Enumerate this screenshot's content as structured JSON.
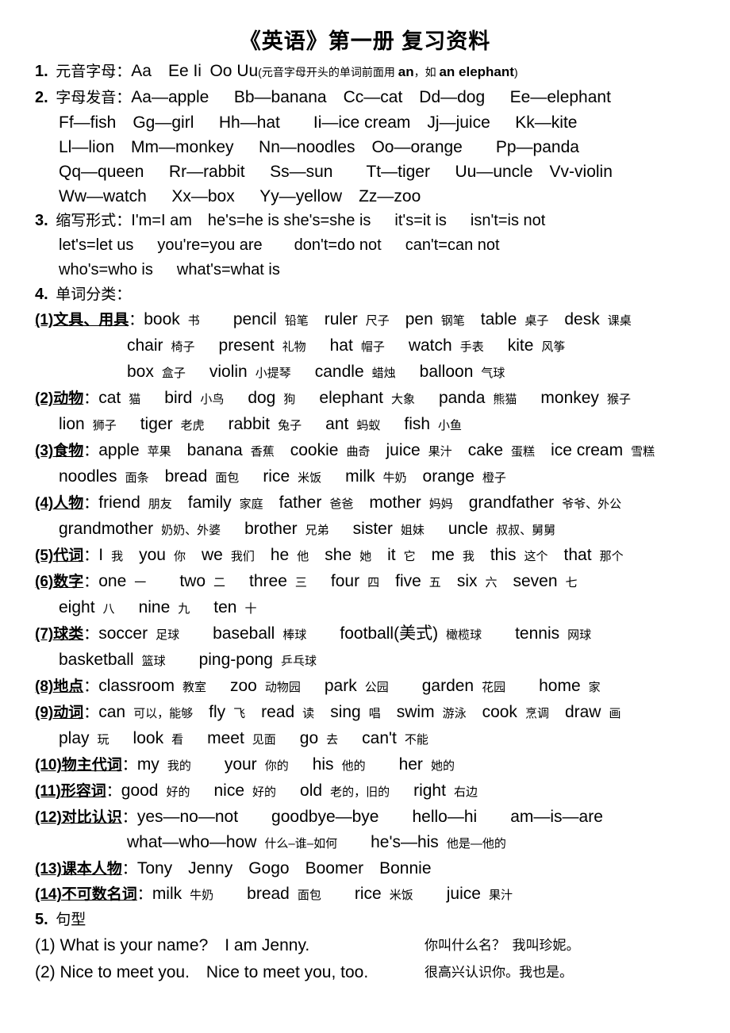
{
  "document": {
    "title": "《英语》第一册 复习资料"
  },
  "sections": {
    "s1": {
      "num": "1.",
      "label": "元音字母：",
      "vowels": "Aa Ee Ii Oo Uu",
      "note_open": "(",
      "note_pre": "元音字母开头的单词前面用 ",
      "note_b1": "an",
      "note_mid": "，如 ",
      "note_b2": "an elephant",
      "note_close": ")"
    },
    "s2": {
      "num": "2.",
      "label": "字母发音：",
      "rows": [
        "Aa—apple  Bb—banana Cc—cat  Dd—dog  Ee—elephant",
        "Ff—fish Gg—girl  Hh—hat   Ii—ice cream Jj—juice  Kk—kite",
        "Ll—lion Mm—monkey  Nn—noodles Oo—orange   Pp—panda",
        "Qq—queen  Rr—rabbit  Ss—sun   Tt—tiger  Uu—uncle Vv-violin",
        "Ww—watch  Xx—box  Yy—yellow Zz—zoo"
      ]
    },
    "s3": {
      "num": "3.",
      "label": "缩写形式：",
      "rows": [
        "I'm=I am he's=he is she's=she is  it's=it is  isn't=is not",
        "let's=let us  you're=you are  don't=do not  can't=can not",
        "who's=who is  what's=what is"
      ]
    },
    "s4": {
      "num": "4.",
      "label": "单词分类：",
      "categories": [
        {
          "id": "cat-1",
          "label": "(1)文具、用具",
          "colon": "：",
          "lines": [
            [
              {
                "en": "book",
                "gl": "书",
                "gap": "sp4"
              },
              {
                "en": "pencil",
                "gl": "铅笔",
                "gap": "sp2"
              },
              {
                "en": "ruler",
                "gl": "尺子",
                "gap": "sp2"
              },
              {
                "en": "pen",
                "gl": "钢笔",
                "gap": "sp2"
              },
              {
                "en": "table",
                "gl": "桌子",
                "gap": "sp2"
              },
              {
                "en": "desk",
                "gl": "课桌",
                "gap": "sp1"
              }
            ],
            [
              {
                "en": "chair",
                "gl": "椅子",
                "gap": "sp3"
              },
              {
                "en": "present",
                "gl": "礼物",
                "gap": "sp3"
              },
              {
                "en": "hat",
                "gl": "帽子",
                "gap": "sp3"
              },
              {
                "en": "watch",
                "gl": "手表",
                "gap": "sp3"
              },
              {
                "en": "kite",
                "gl": "风筝",
                "gap": "sp1"
              }
            ],
            [
              {
                "en": "box",
                "gl": "盒子",
                "gap": "sp3"
              },
              {
                "en": "violin",
                "gl": "小提琴",
                "gap": "sp3"
              },
              {
                "en": "candle",
                "gl": "蜡烛",
                "gap": "sp3"
              },
              {
                "en": "balloon",
                "gl": "气球",
                "gap": "sp1"
              }
            ]
          ],
          "indent": [
            "",
            "ind3",
            "ind3"
          ]
        },
        {
          "id": "cat-2",
          "label": "(2)动物",
          "colon": "：",
          "lines": [
            [
              {
                "en": "cat",
                "gl": "猫",
                "gap": "sp3"
              },
              {
                "en": "bird",
                "gl": "小鸟",
                "gap": "sp3"
              },
              {
                "en": "dog",
                "gl": "狗",
                "gap": "sp3"
              },
              {
                "en": "elephant",
                "gl": "大象",
                "gap": "sp3"
              },
              {
                "en": "panda",
                "gl": "熊猫",
                "gap": "sp3"
              },
              {
                "en": "monkey",
                "gl": "猴子",
                "gap": "sp1"
              }
            ],
            [
              {
                "en": "lion",
                "gl": "狮子",
                "gap": "sp3"
              },
              {
                "en": "tiger",
                "gl": "老虎",
                "gap": "sp3"
              },
              {
                "en": "rabbit",
                "gl": "兔子",
                "gap": "sp3"
              },
              {
                "en": "ant",
                "gl": "蚂蚁",
                "gap": "sp3"
              },
              {
                "en": "fish",
                "gl": "小鱼",
                "gap": "sp1"
              }
            ]
          ],
          "indent": [
            "",
            "ind1"
          ]
        },
        {
          "id": "cat-3",
          "label": "(3)食物",
          "colon": "：",
          "lines": [
            [
              {
                "en": "apple",
                "gl": "苹果",
                "gap": "sp2"
              },
              {
                "en": "banana",
                "gl": "香蕉",
                "gap": "sp2"
              },
              {
                "en": "cookie",
                "gl": "曲奇",
                "gap": "sp2"
              },
              {
                "en": "juice",
                "gl": "果汁",
                "gap": "sp2"
              },
              {
                "en": "cake",
                "gl": "蛋糕",
                "gap": "sp2"
              },
              {
                "en": "ice cream",
                "gl": "雪糕",
                "gap": "sp1"
              }
            ],
            [
              {
                "en": "noodles",
                "gl": "面条",
                "gap": "sp2"
              },
              {
                "en": "bread",
                "gl": "面包",
                "gap": "sp3"
              },
              {
                "en": "rice",
                "gl": "米饭",
                "gap": "sp3"
              },
              {
                "en": "milk",
                "gl": "牛奶",
                "gap": "sp2"
              },
              {
                "en": "orange",
                "gl": "橙子",
                "gap": "sp1"
              }
            ]
          ],
          "indent": [
            "",
            "ind1"
          ]
        },
        {
          "id": "cat-4",
          "label": "(4)人物",
          "colon": "：",
          "lines": [
            [
              {
                "en": "friend",
                "gl": "朋友",
                "gap": "sp2"
              },
              {
                "en": "family",
                "gl": "家庭",
                "gap": "sp2"
              },
              {
                "en": "father",
                "gl": "爸爸",
                "gap": "sp2"
              },
              {
                "en": "mother",
                "gl": "妈妈",
                "gap": "sp2"
              },
              {
                "en": "grandfather",
                "gl": "爷爷、外公",
                "gap": "sp1"
              }
            ],
            [
              {
                "en": "grandmother",
                "gl": "奶奶、外婆",
                "gap": "sp3"
              },
              {
                "en": "brother",
                "gl": "兄弟",
                "gap": "sp3"
              },
              {
                "en": "sister",
                "gl": "姐妹",
                "gap": "sp3"
              },
              {
                "en": "uncle",
                "gl": "叔叔、舅舅",
                "gap": "sp1"
              }
            ]
          ],
          "indent": [
            "",
            "ind1"
          ]
        },
        {
          "id": "cat-5",
          "label": "(5)代词",
          "colon": "：",
          "lines": [
            [
              {
                "en": "I",
                "gl": "我",
                "gap": "sp2"
              },
              {
                "en": "you",
                "gl": "你",
                "gap": "sp2"
              },
              {
                "en": "we",
                "gl": "我们",
                "gap": "sp2"
              },
              {
                "en": "he",
                "gl": "他",
                "gap": "sp2"
              },
              {
                "en": "she",
                "gl": "她",
                "gap": "sp2"
              },
              {
                "en": "it",
                "gl": "它",
                "gap": "sp2"
              },
              {
                "en": "me",
                "gl": "我",
                "gap": "sp2"
              },
              {
                "en": "this",
                "gl": "这个",
                "gap": "sp2"
              },
              {
                "en": "that",
                "gl": "那个",
                "gap": "sp1"
              }
            ]
          ],
          "indent": [
            ""
          ]
        },
        {
          "id": "cat-6",
          "label": "(6)数字",
          "colon": "：",
          "lines": [
            [
              {
                "en": "one",
                "gl": "一",
                "gap": "sp4"
              },
              {
                "en": "two",
                "gl": "二",
                "gap": "sp3"
              },
              {
                "en": "three",
                "gl": "三",
                "gap": "sp3"
              },
              {
                "en": "four",
                "gl": "四",
                "gap": "sp2"
              },
              {
                "en": "five",
                "gl": "五",
                "gap": "sp2"
              },
              {
                "en": "six",
                "gl": "六",
                "gap": "sp2"
              },
              {
                "en": "seven",
                "gl": "七",
                "gap": "sp1"
              }
            ],
            [
              {
                "en": "eight",
                "gl": "八",
                "gap": "sp3"
              },
              {
                "en": "nine",
                "gl": "九",
                "gap": "sp3"
              },
              {
                "en": "ten",
                "gl": "十",
                "gap": "sp1"
              }
            ]
          ],
          "indent": [
            "",
            "ind1"
          ]
        },
        {
          "id": "cat-7",
          "label": "(7)球类",
          "colon": "：",
          "lines": [
            [
              {
                "en": "soccer",
                "gl": "足球",
                "gap": "sp4"
              },
              {
                "en": "baseball",
                "gl": "棒球",
                "gap": "sp4"
              },
              {
                "en": "football(美式)",
                "gl": "橄榄球",
                "gap": "sp4"
              },
              {
                "en": "tennis",
                "gl": "网球",
                "gap": "sp1"
              }
            ],
            [
              {
                "en": "basketball",
                "gl": "篮球",
                "gap": "sp4"
              },
              {
                "en": "ping-pong",
                "gl": "乒乓球",
                "gap": "sp1"
              }
            ]
          ],
          "indent": [
            "",
            "ind1"
          ]
        },
        {
          "id": "cat-8",
          "label": "(8)地点",
          "colon": "：",
          "lines": [
            [
              {
                "en": "classroom",
                "gl": "教室",
                "gap": "sp3"
              },
              {
                "en": "zoo",
                "gl": "动物园",
                "gap": "sp3"
              },
              {
                "en": "park",
                "gl": "公园",
                "gap": "sp4"
              },
              {
                "en": "garden",
                "gl": "花园",
                "gap": "sp4"
              },
              {
                "en": "home",
                "gl": "家",
                "gap": "sp1"
              }
            ]
          ],
          "indent": [
            ""
          ]
        },
        {
          "id": "cat-9",
          "label": "(9)动词",
          "colon": "：",
          "lines": [
            [
              {
                "en": "can",
                "gl": "可以，能够",
                "gap": "sp2"
              },
              {
                "en": "fly",
                "gl": "飞",
                "gap": "sp2"
              },
              {
                "en": "read",
                "gl": "读",
                "gap": "sp2"
              },
              {
                "en": "sing",
                "gl": "唱",
                "gap": "sp2"
              },
              {
                "en": "swim",
                "gl": "游泳",
                "gap": "sp2"
              },
              {
                "en": "cook",
                "gl": "烹调",
                "gap": "sp2"
              },
              {
                "en": "draw",
                "gl": "画",
                "gap": "sp1"
              }
            ],
            [
              {
                "en": "play",
                "gl": "玩",
                "gap": "sp3"
              },
              {
                "en": "look",
                "gl": "看",
                "gap": "sp3"
              },
              {
                "en": "meet",
                "gl": "见面",
                "gap": "sp3"
              },
              {
                "en": "go",
                "gl": "去",
                "gap": "sp3"
              },
              {
                "en": "can't",
                "gl": "不能",
                "gap": "sp1"
              }
            ]
          ],
          "indent": [
            "",
            "ind1"
          ]
        },
        {
          "id": "cat-10",
          "label": "(10)物主代词",
          "colon": "：",
          "lines": [
            [
              {
                "en": "my",
                "gl": "我的",
                "gap": "sp4"
              },
              {
                "en": "your",
                "gl": "你的",
                "gap": "sp3"
              },
              {
                "en": "his",
                "gl": "他的",
                "gap": "sp4"
              },
              {
                "en": "her",
                "gl": "她的",
                "gap": "sp1"
              }
            ]
          ],
          "indent": [
            ""
          ]
        },
        {
          "id": "cat-11",
          "label": "(11)形容词",
          "colon": "：",
          "lines": [
            [
              {
                "en": "good",
                "gl": "好的",
                "gap": "sp3"
              },
              {
                "en": "nice",
                "gl": "好的",
                "gap": "sp3"
              },
              {
                "en": "old",
                "gl": "老的，旧的",
                "gap": "sp3"
              },
              {
                "en": "right",
                "gl": "右边",
                "gap": "sp1"
              }
            ]
          ],
          "indent": [
            ""
          ]
        },
        {
          "id": "cat-12",
          "label": "(12)对比认识",
          "colon": "：",
          "lines": [
            [
              {
                "en": "yes—no—not",
                "gl": "",
                "gap": "sp4"
              },
              {
                "en": "goodbye—bye",
                "gl": "",
                "gap": "sp4"
              },
              {
                "en": "hello—hi",
                "gl": "",
                "gap": "sp4"
              },
              {
                "en": "am—is—are",
                "gl": "",
                "gap": "sp1"
              }
            ],
            [
              {
                "en": "what—who—how",
                "gl": "什么–谁–如何",
                "gap": "sp4"
              },
              {
                "en": "he's—his",
                "gl": "他是—他的",
                "gap": "sp1"
              }
            ]
          ],
          "indent": [
            "",
            "ind3"
          ]
        },
        {
          "id": "cat-13",
          "label": "(13)课本人物",
          "colon": "：",
          "lines": [
            [
              {
                "en": "Tony",
                "gl": "",
                "gap": "sp2"
              },
              {
                "en": "Jenny",
                "gl": "",
                "gap": "sp2"
              },
              {
                "en": "Gogo",
                "gl": "",
                "gap": "sp2"
              },
              {
                "en": "Boomer",
                "gl": "",
                "gap": "sp2"
              },
              {
                "en": "Bonnie",
                "gl": "",
                "gap": "sp1"
              }
            ]
          ],
          "indent": [
            ""
          ]
        },
        {
          "id": "cat-14",
          "label": "(14)不可数名词",
          "colon": "：",
          "lines": [
            [
              {
                "en": "milk",
                "gl": "牛奶",
                "gap": "sp4"
              },
              {
                "en": "bread",
                "gl": "面包",
                "gap": "sp4"
              },
              {
                "en": "rice",
                "gl": "米饭",
                "gap": "sp4"
              },
              {
                "en": "juice",
                "gl": "果汁",
                "gap": "sp1"
              }
            ]
          ],
          "indent": [
            ""
          ]
        }
      ]
    },
    "s5": {
      "num": "5.",
      "label": "句型",
      "sentences": [
        {
          "index": "(1)",
          "en": "What is your name?  I am Jenny.",
          "zh": "你叫什么名？ 我叫珍妮。"
        },
        {
          "index": "(2)",
          "en": "Nice to meet you.  Nice to meet you, too.",
          "zh": "很高兴认识你。我也是。"
        }
      ]
    }
  }
}
